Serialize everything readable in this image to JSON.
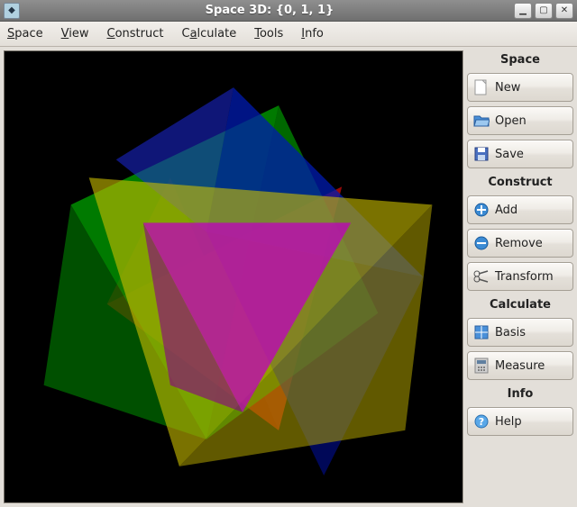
{
  "window": {
    "title": "Space 3D: {0, 1, 1}"
  },
  "menu": {
    "items": [
      "Space",
      "View",
      "Construct",
      "Calculate",
      "Tools",
      "Info"
    ]
  },
  "sidebar": {
    "sections": [
      {
        "title": "Space",
        "buttons": [
          {
            "name": "new-button",
            "icon": "new-icon",
            "label": "New"
          },
          {
            "name": "open-button",
            "icon": "open-icon",
            "label": "Open"
          },
          {
            "name": "save-button",
            "icon": "save-icon",
            "label": "Save"
          }
        ]
      },
      {
        "title": "Construct",
        "buttons": [
          {
            "name": "add-button",
            "icon": "add-icon",
            "label": "Add"
          },
          {
            "name": "remove-button",
            "icon": "remove-icon",
            "label": "Remove"
          },
          {
            "name": "transform-button",
            "icon": "transform-icon",
            "label": "Transform"
          }
        ]
      },
      {
        "title": "Calculate",
        "buttons": [
          {
            "name": "basis-button",
            "icon": "basis-icon",
            "label": "Basis"
          },
          {
            "name": "measure-button",
            "icon": "measure-icon",
            "label": "Measure"
          }
        ]
      },
      {
        "title": "Info",
        "buttons": [
          {
            "name": "help-button",
            "icon": "help-icon",
            "label": "Help"
          }
        ]
      }
    ]
  }
}
